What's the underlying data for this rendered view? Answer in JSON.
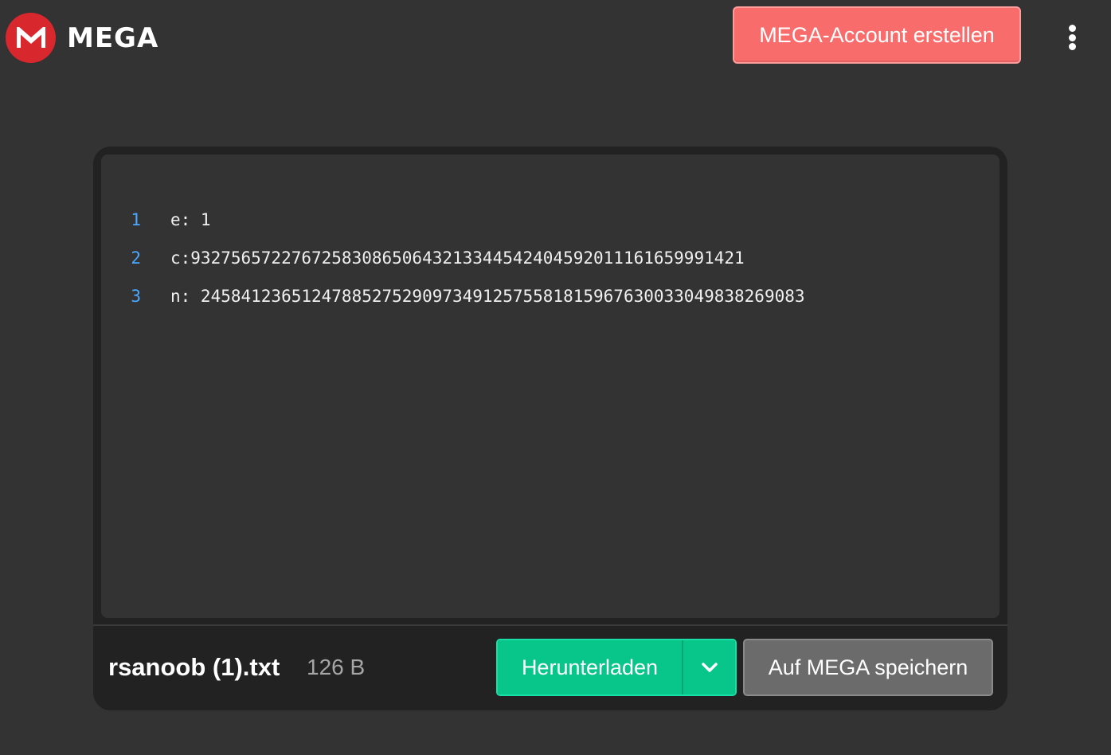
{
  "header": {
    "brand": "MEGA",
    "create_account_label": "MEGA-Account erstellen",
    "brand_color": "#d9272e",
    "create_account_color": "#f96c6c"
  },
  "editor": {
    "lines": [
      {
        "number": "1",
        "text": "e: 1"
      },
      {
        "number": "2",
        "text": "c:9327565722767258308650643213344542404592011161659991421"
      },
      {
        "number": "3",
        "text": "n: 245841236512478852752909734912575581815967630033049838269083"
      }
    ]
  },
  "footer": {
    "file_name": "rsanoob (1).txt",
    "file_size": "126 B",
    "download_label": "Herunterladen",
    "save_label": "Auf MEGA speichern",
    "download_color": "#08c58a"
  },
  "icons": {
    "logo": "mega-logo-icon",
    "menu": "more-vertical-icon",
    "dropdown": "chevron-down-icon"
  }
}
